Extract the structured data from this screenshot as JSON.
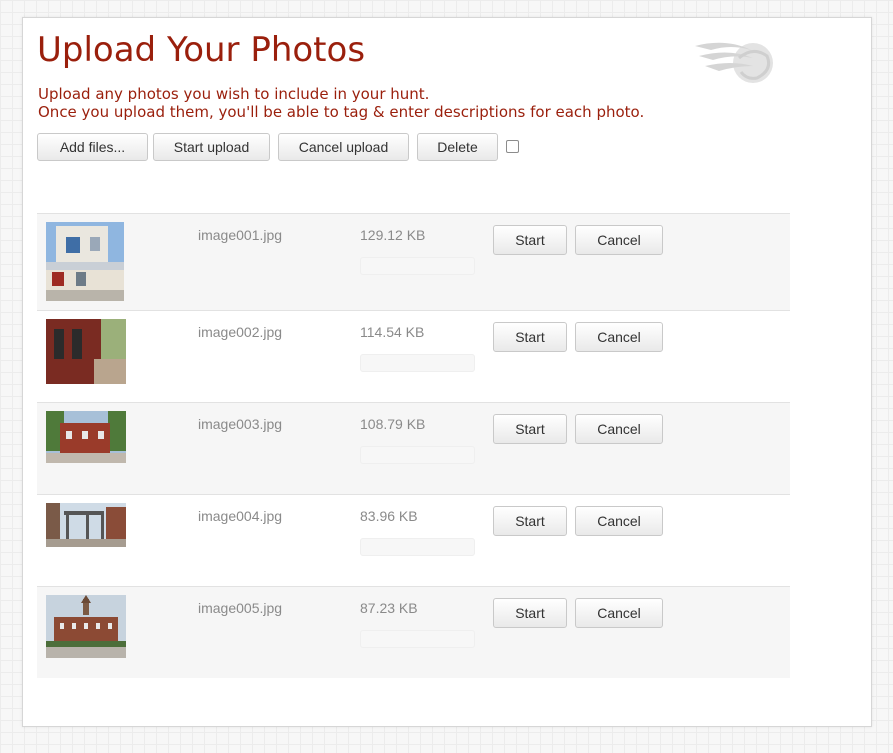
{
  "page": {
    "title": "Upload Your Photos",
    "intro_lines": [
      "Upload any photos you wish to include in your hunt.",
      "Once you upload them, you'll be able to tag & enter descriptions for each photo."
    ]
  },
  "toolbar": {
    "add_files": "Add files...",
    "start_upload": "Start upload",
    "cancel_upload": "Cancel upload",
    "delete": "Delete",
    "select_all_checked": false
  },
  "files": [
    {
      "name": "image001.jpg",
      "size": "129.12 KB",
      "start": "Start",
      "cancel": "Cancel"
    },
    {
      "name": "image002.jpg",
      "size": "114.54 KB",
      "start": "Start",
      "cancel": "Cancel"
    },
    {
      "name": "image003.jpg",
      "size": "108.79 KB",
      "start": "Start",
      "cancel": "Cancel"
    },
    {
      "name": "image004.jpg",
      "size": "83.96 KB",
      "start": "Start",
      "cancel": "Cancel"
    },
    {
      "name": "image005.jpg",
      "size": "87.23 KB",
      "start": "Start",
      "cancel": "Cancel"
    }
  ],
  "colors": {
    "accent": "#9a1f0c",
    "muted_text": "#8a8a8a"
  },
  "icons": {
    "logo": "swoosh-logo"
  }
}
